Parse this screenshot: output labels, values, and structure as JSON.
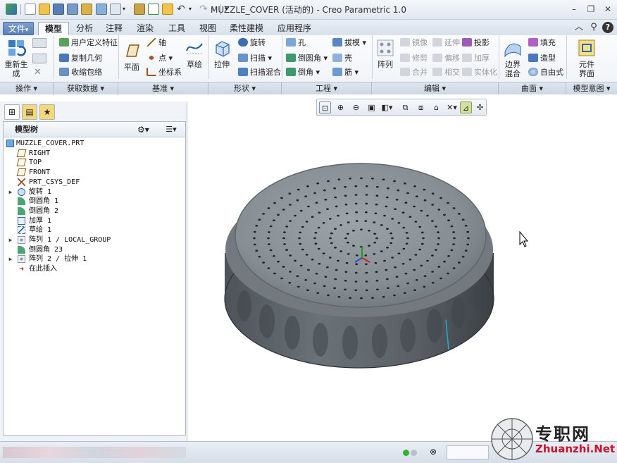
{
  "window": {
    "title": "MUZZLE_COVER (活动的) - Creo Parametric 1.0",
    "controls": [
      "–",
      "❐",
      "✕"
    ]
  },
  "tabs": [
    {
      "label": "文件",
      "arrow": "▾"
    },
    {
      "label": "模型"
    },
    {
      "label": "分析"
    },
    {
      "label": "注释"
    },
    {
      "label": "渲染"
    },
    {
      "label": "工具"
    },
    {
      "label": "视图"
    },
    {
      "label": "柔性建模"
    },
    {
      "label": "应用程序"
    }
  ],
  "ribbon": {
    "operations": {
      "regen_line1": "重新生",
      "regen_line2": "成"
    },
    "get_data": {
      "udf": "用户定义特征",
      "copy_geom": "复制几何",
      "shrinkwrap": "收缩包络"
    },
    "datum": {
      "plane": "平面",
      "axis": "轴",
      "point": "点",
      "csys": "坐标系",
      "sketch": "草绘"
    },
    "shapes": {
      "extrude": "拉伸",
      "revolve": "旋转",
      "sweep": "扫描",
      "swept_blend": "扫描混合"
    },
    "engineering": {
      "hole": "孔",
      "draft": "拔模",
      "round": "倒圆角",
      "shell": "壳",
      "chamfer": "倒角",
      "rib": "筋"
    },
    "editing": {
      "pattern": "阵列",
      "mirror": "镜像",
      "extend": "延伸",
      "project": "投影",
      "trim": "修剪",
      "offset": "偏移",
      "thicken": "加厚",
      "merge": "合并",
      "intersect": "相交",
      "solidify": "实体化"
    },
    "surfaces": {
      "fill": "填充",
      "boundary_line1": "边界",
      "boundary_line2": "混合",
      "style": "造型",
      "freestyle": "自由式"
    },
    "model_intent": {
      "component_line1": "元件",
      "component_line2": "界面"
    },
    "groups": [
      "操作",
      "获取数据",
      "基准",
      "形状",
      "工程",
      "编辑",
      "曲面",
      "模型意图"
    ]
  },
  "model_tree": {
    "header": "模型树",
    "items": [
      {
        "label": "MUZZLE_COVER.PRT",
        "icon": "part-icon",
        "expandable": false
      },
      {
        "label": "RIGHT",
        "icon": "datum-plane-icon",
        "expandable": false
      },
      {
        "label": "TOP",
        "icon": "datum-plane-icon",
        "expandable": false
      },
      {
        "label": "FRONT",
        "icon": "datum-plane-icon",
        "expandable": false
      },
      {
        "label": "PRT_CSYS_DEF",
        "icon": "csys-icon",
        "expandable": false
      },
      {
        "label": "旋转 1",
        "icon": "revolve-icon",
        "expandable": true
      },
      {
        "label": "倒圆角 1",
        "icon": "round-icon",
        "expandable": false
      },
      {
        "label": "倒圆角 2",
        "icon": "round-icon",
        "expandable": false
      },
      {
        "label": "加厚 1",
        "icon": "thicken-icon",
        "expandable": false
      },
      {
        "label": "草绘 1",
        "icon": "sketch-icon",
        "expandable": false
      },
      {
        "label": "阵列 1 / LOCAL_GROUP",
        "icon": "pattern-icon",
        "expandable": true
      },
      {
        "label": "倒圆角 23",
        "icon": "round-icon",
        "expandable": false
      },
      {
        "label": "阵列 2 / 拉伸 1",
        "icon": "pattern-icon",
        "expandable": true
      },
      {
        "label": "在此插入",
        "icon": "insert-here-icon",
        "expandable": false
      }
    ]
  },
  "watermark": {
    "cn": "专职网",
    "en": "Zhuanzhi.Net"
  },
  "colors": {
    "accent": "#5a7fb8",
    "model_gray": "#7f868c",
    "watermark_red": "#c8102e"
  }
}
